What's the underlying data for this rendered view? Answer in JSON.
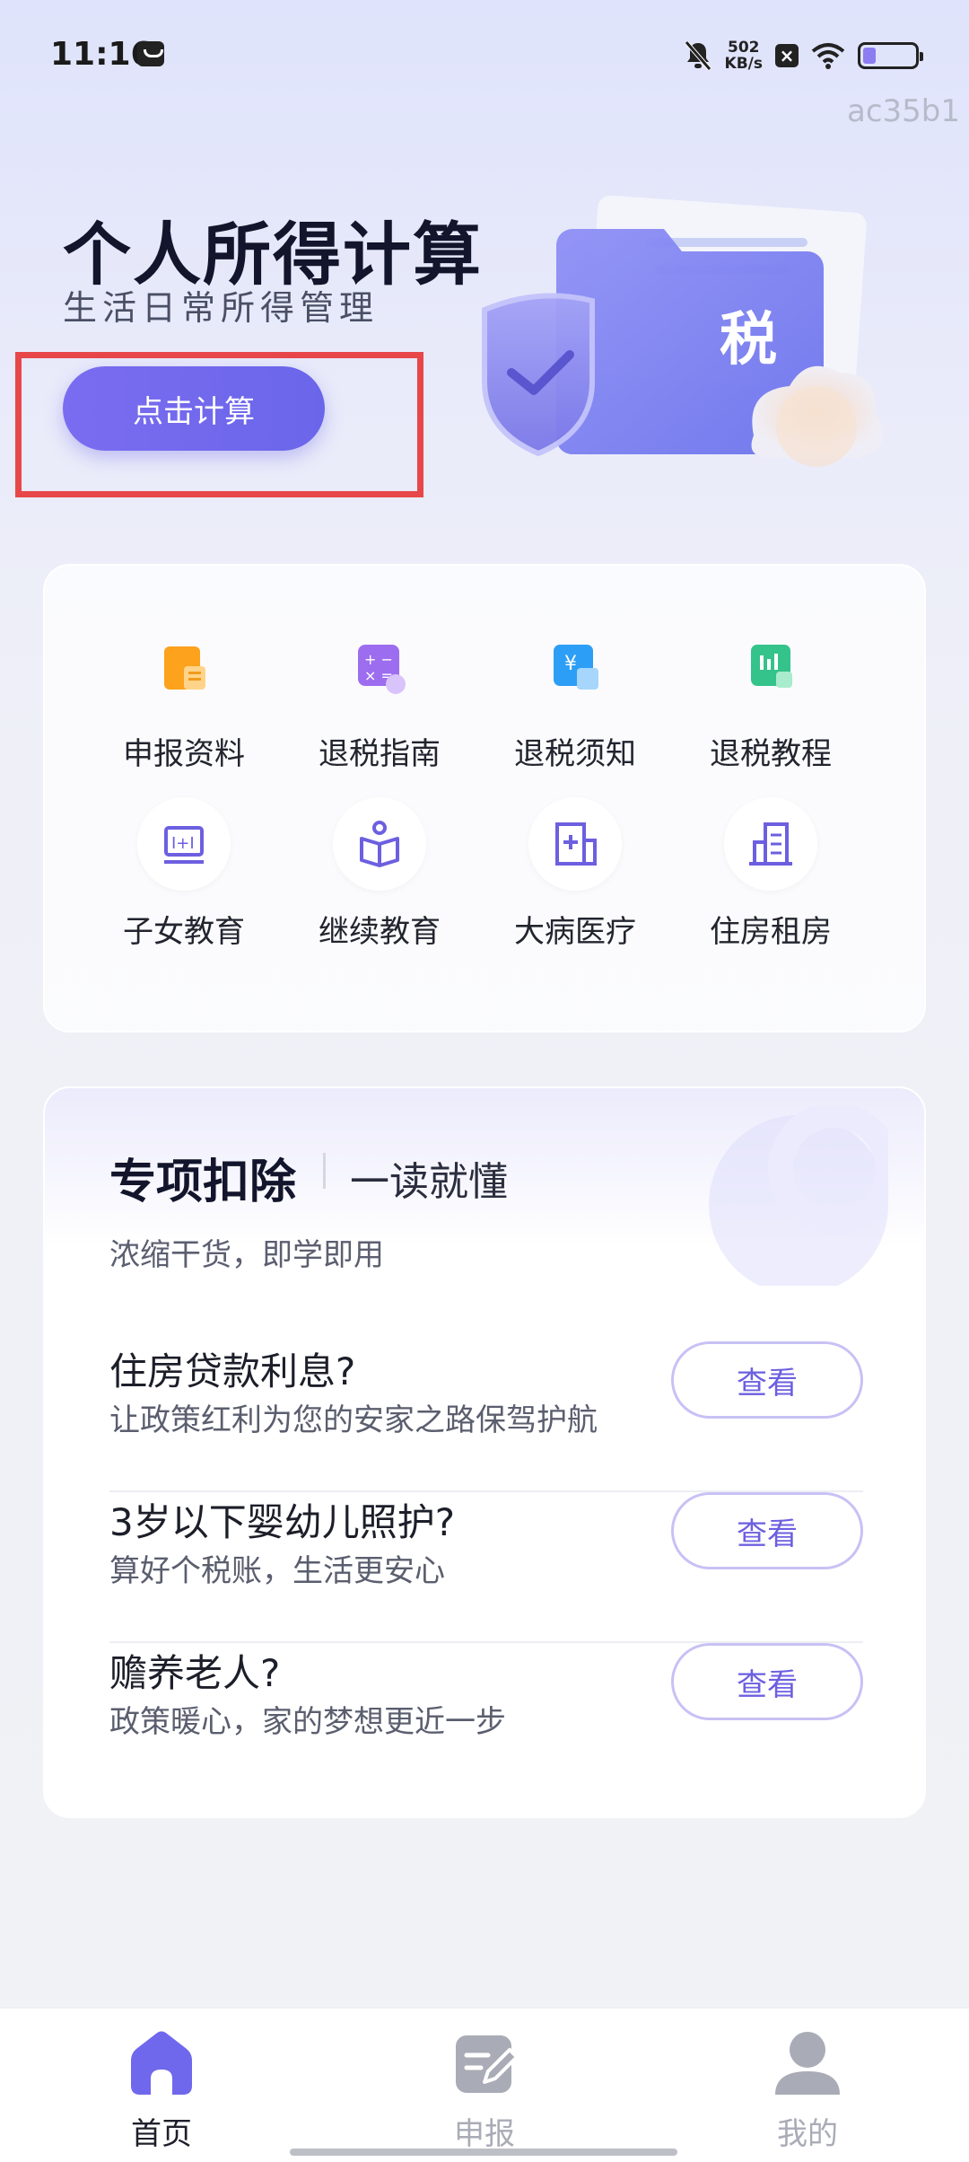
{
  "status_bar": {
    "time": "11:16",
    "net_speed_value": "502",
    "net_speed_unit": "KB/s"
  },
  "watermark": "ac35b1",
  "hero": {
    "title": "个人所得计算",
    "subtitle": "生活日常所得管理",
    "calc_button": "点击计算",
    "badge_char": "税"
  },
  "menu": {
    "items": [
      {
        "label": "申报资料",
        "icon": "document-orange-icon"
      },
      {
        "label": "退税指南",
        "icon": "calculator-purple-icon"
      },
      {
        "label": "退税须知",
        "icon": "yuan-doc-blue-icon"
      },
      {
        "label": "退税教程",
        "icon": "chart-green-icon"
      },
      {
        "label": "子女教育",
        "icon": "blackboard-icon"
      },
      {
        "label": "继续教育",
        "icon": "reading-person-icon"
      },
      {
        "label": "大病医疗",
        "icon": "hospital-icon"
      },
      {
        "label": "住房租房",
        "icon": "building-icon"
      }
    ]
  },
  "deduction": {
    "title": "专项扣除",
    "title_secondary": "一读就懂",
    "description": "浓缩干货，即学即用",
    "topics": [
      {
        "title": "住房贷款利息?",
        "desc": "让政策红利为您的安家之路保驾护航",
        "button": "查看"
      },
      {
        "title": "3岁以下婴幼儿照护?",
        "desc": "算好个税账，生活更安心",
        "button": "查看"
      },
      {
        "title": "赡养老人?",
        "desc": "政策暖心，家的梦想更近一步",
        "button": "查看"
      }
    ]
  },
  "nav": {
    "items": [
      {
        "label": "首页",
        "active": true
      },
      {
        "label": "申报",
        "active": false
      },
      {
        "label": "我的",
        "active": false
      }
    ]
  },
  "colors": {
    "accent": "#6f68ec",
    "highlight_box": "#e8474a",
    "inactive": "#a9acb6"
  },
  "battery_level": 0.25
}
